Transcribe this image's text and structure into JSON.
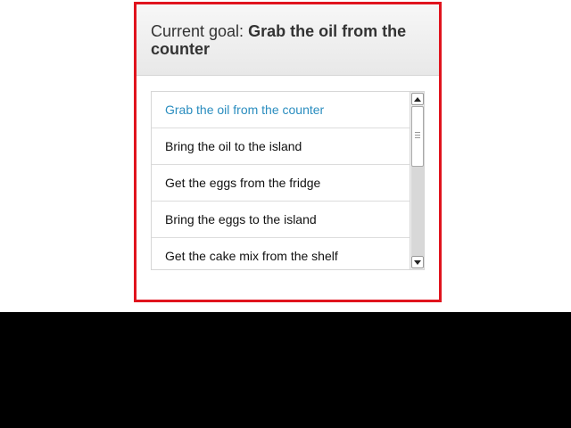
{
  "header": {
    "prefix": "Current goal:",
    "goal": "Grab the oil from the counter"
  },
  "tasks": [
    {
      "label": "Grab the oil from the counter",
      "active": true
    },
    {
      "label": "Bring the oil to the island",
      "active": false
    },
    {
      "label": "Get the eggs from the fridge",
      "active": false
    },
    {
      "label": "Bring the eggs to the island",
      "active": false
    },
    {
      "label": "Get the cake mix from the shelf",
      "active": false
    }
  ],
  "colors": {
    "frame_border": "#e0141e",
    "active_item": "#2a8dbf"
  },
  "icons": {
    "scroll_up": "triangle-up-icon",
    "scroll_down": "triangle-down-icon"
  }
}
